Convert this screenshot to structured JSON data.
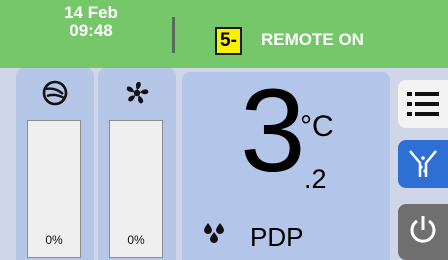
{
  "header": {
    "date": "14 Feb",
    "time": "09:48",
    "alarm_badge": "5-",
    "status": "REMOTE ON"
  },
  "gauges": [
    {
      "icon": "compressor-icon",
      "value_label": "0%",
      "level_fraction": 0
    },
    {
      "icon": "fan-icon",
      "value_label": "0%",
      "level_fraction": 0
    }
  ],
  "reading": {
    "value_int": "3",
    "value_dec": ".2",
    "unit": "°C",
    "parameter": "PDP",
    "icon": "water-drops-icon"
  },
  "side_buttons": [
    {
      "icon": "menu-icon"
    },
    {
      "icon": "dryer-filter-icon"
    },
    {
      "icon": "power-icon"
    }
  ],
  "colors": {
    "header_green": "#76c66a",
    "alarm_yellow": "#f8f200",
    "panel_blue": "#b3c5e8",
    "active_button_blue": "#2e6fd6"
  }
}
